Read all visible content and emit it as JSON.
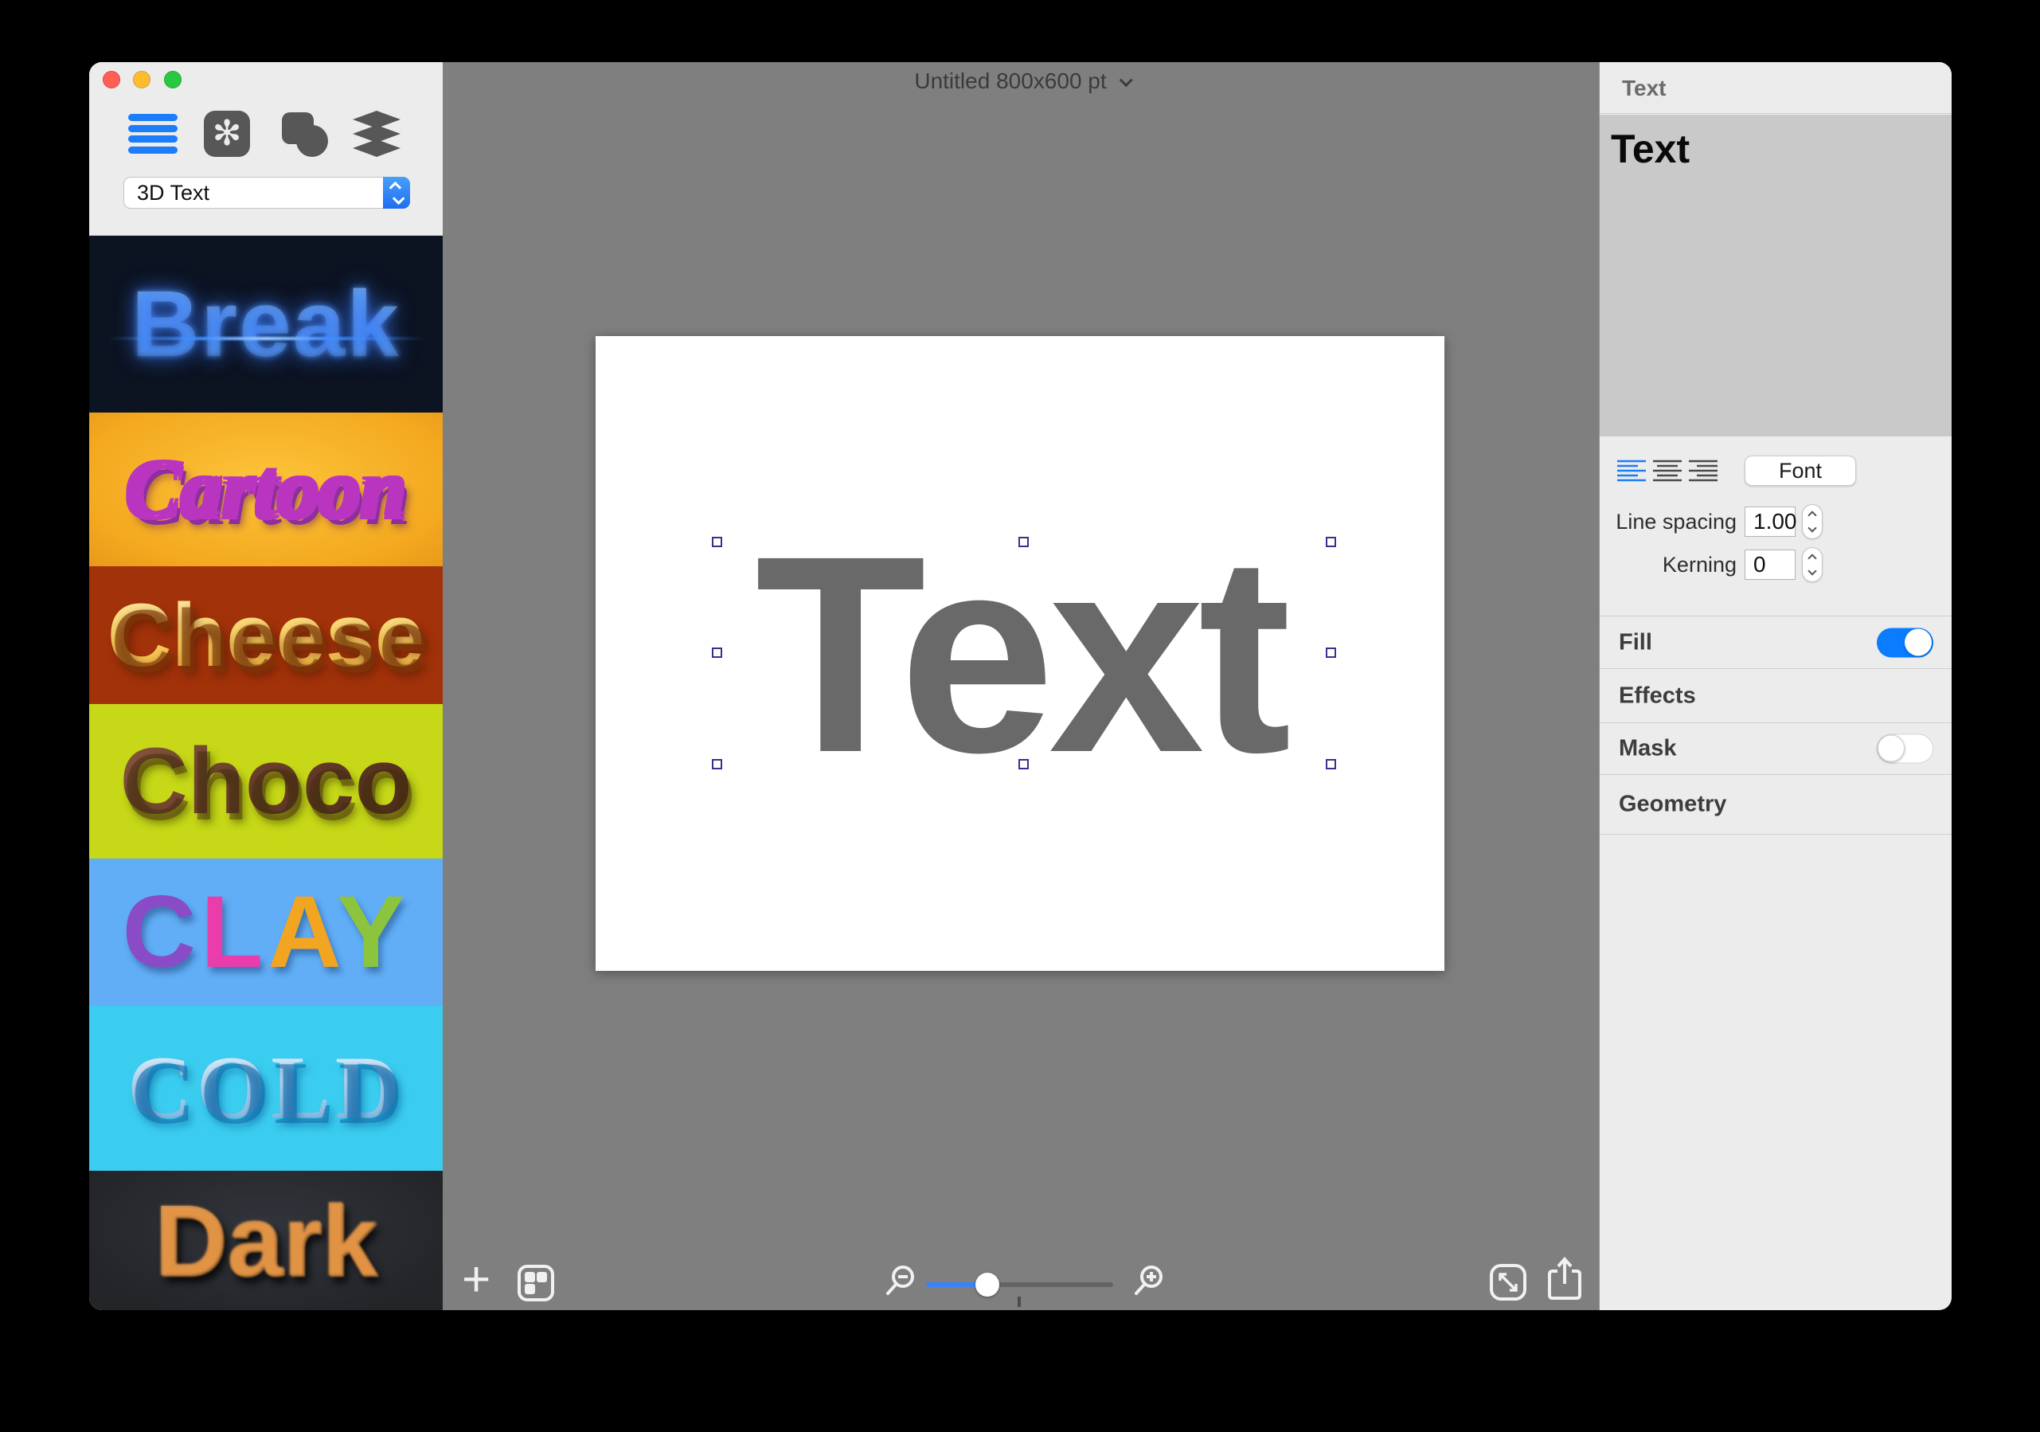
{
  "window": {
    "title": "Untitled 800x600 pt",
    "traffic_lights": [
      "close",
      "minimize",
      "zoom"
    ]
  },
  "sidebar": {
    "dropdown_value": "3D Text",
    "toolbar_icons": [
      "content-list-icon",
      "styles-icon",
      "shapes-icon",
      "layers-icon"
    ],
    "presets": [
      {
        "label": "Break"
      },
      {
        "label": "Cartoon"
      },
      {
        "label": "Cheese"
      },
      {
        "label": "Choco"
      },
      {
        "label": "CLAY",
        "letters": [
          {
            "char": "C",
            "color": "#8a4cc6"
          },
          {
            "char": "L",
            "color": "#e83daa"
          },
          {
            "char": "A",
            "color": "#f2a521"
          },
          {
            "char": "Y",
            "color": "#8cc43d"
          }
        ]
      },
      {
        "label": "COLD"
      },
      {
        "label": "Dark"
      }
    ]
  },
  "canvas": {
    "object_text": "Text",
    "zoom_slider": {
      "value_fraction": 0.34
    }
  },
  "inspector": {
    "header": "Text",
    "content_text": "Text",
    "font_button_label": "Font",
    "alignment": [
      "left",
      "center",
      "right"
    ],
    "alignment_selected": "left",
    "line_spacing_label": "Line spacing",
    "line_spacing_value": "1.00",
    "kerning_label": "Kerning",
    "kerning_value": "0",
    "sections": [
      {
        "label": "Fill",
        "toggle": "on"
      },
      {
        "label": "Effects"
      },
      {
        "label": "Mask",
        "toggle": "off"
      },
      {
        "label": "Geometry"
      }
    ]
  },
  "colors": {
    "accent_blue": "#0a7cff",
    "canvas_gray": "#7f7f7f",
    "panel_gray": "#ececec",
    "text_gray": "#696969"
  }
}
